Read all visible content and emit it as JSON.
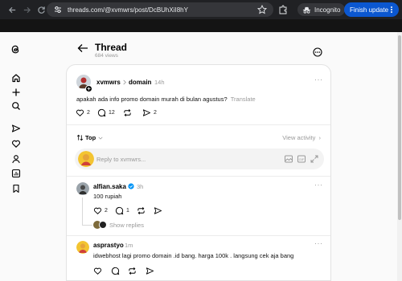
{
  "browser": {
    "url": "threads.com/@xvmwrs/post/DcBUhXiI8hY",
    "incognito_label": "Incognito",
    "update_label": "Finish update"
  },
  "header": {
    "title": "Thread",
    "views": "684 views"
  },
  "post": {
    "username": "xvmwrs",
    "topic": "domain",
    "time": "14h",
    "text": "apakah ada info promo domain murah di bulan agustus?",
    "translate": "Translate",
    "likes": "2",
    "comments": "12",
    "shares": "2"
  },
  "sort": {
    "label": "Top",
    "view_activity": "View activity"
  },
  "reply_input": {
    "placeholder": "Reply to xvmwrs..."
  },
  "replies": [
    {
      "username": "alfian.saka",
      "time": "3h",
      "text": "100 rupiah",
      "likes": "2",
      "comments": "1",
      "show_replies": "Show replies"
    },
    {
      "username": "asprastyo",
      "time": "1m",
      "text": "idwebhost lagi promo domain .id bang. harga 100k . langsung cek aja bang"
    }
  ],
  "colors": {
    "chrome_bg": "#202124",
    "update_button": "#0b57d0",
    "verified": "#0095f6"
  },
  "icons": [
    "back-icon",
    "forward-icon",
    "reload-icon",
    "tune-icon",
    "star-icon",
    "extension-icon",
    "incognito-icon",
    "more-vert-icon",
    "threads-logo-icon",
    "home-icon",
    "plus-icon",
    "search-icon",
    "send-icon",
    "heart-icon",
    "profile-icon",
    "insights-icon",
    "bookmark-icon",
    "more-circle-icon",
    "chevron-right-icon",
    "sort-icon",
    "gif-icon",
    "expand-icon",
    "comment-icon",
    "repost-icon",
    "share-icon",
    "verified-icon"
  ]
}
